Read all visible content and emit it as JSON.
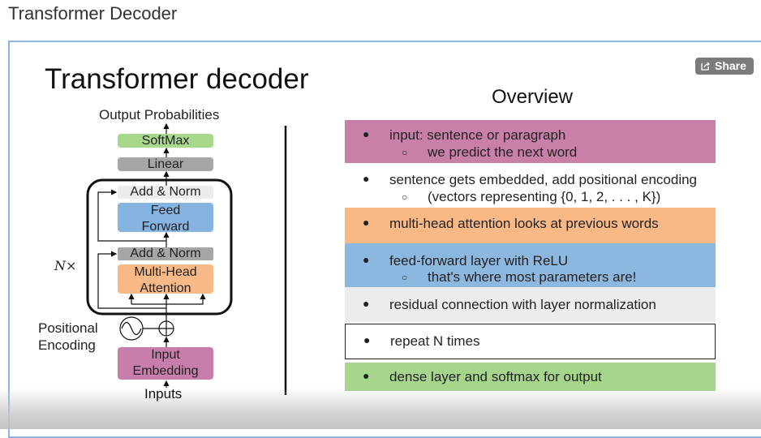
{
  "page_title": "Transformer Decoder",
  "share_label": "Share",
  "slide": {
    "title": "Transformer decoder",
    "diagram": {
      "output": "Output Probabilities",
      "softmax": "SoftMax",
      "linear": "Linear",
      "add_norm_top": "Add & Norm",
      "feed": "Feed",
      "forward": "Forward",
      "add_norm_bottom": "Add & Norm",
      "mha1": "Multi-Head",
      "mha2": "Attention",
      "repeat": "N×",
      "pos1": "Positional",
      "pos2": "Encoding",
      "emb1": "Input",
      "emb2": "Embedding",
      "inputs": "Inputs"
    },
    "overview_title": "Overview",
    "rows": [
      {
        "text": "input: sentence or paragraph",
        "sub": "we predict the next word",
        "color": "#c880a8"
      },
      {
        "text": "sentence gets embedded, add positional encoding",
        "sub": "(vectors representing {0, 1, 2, . . . , K})",
        "color": "#ffffff"
      },
      {
        "text": "multi-head attention looks at previous words",
        "color": "#f8b987"
      },
      {
        "text": "feed-forward layer with ReLU",
        "sub": "that's where most parameters are!",
        "color": "#8cb8e0"
      },
      {
        "text": "residual connection with layer normalization",
        "color": "#ececec"
      },
      {
        "text": "repeat N times",
        "color": "#ffffff"
      },
      {
        "text": "dense layer and softmax for output",
        "color": "#a5d68c"
      }
    ]
  }
}
